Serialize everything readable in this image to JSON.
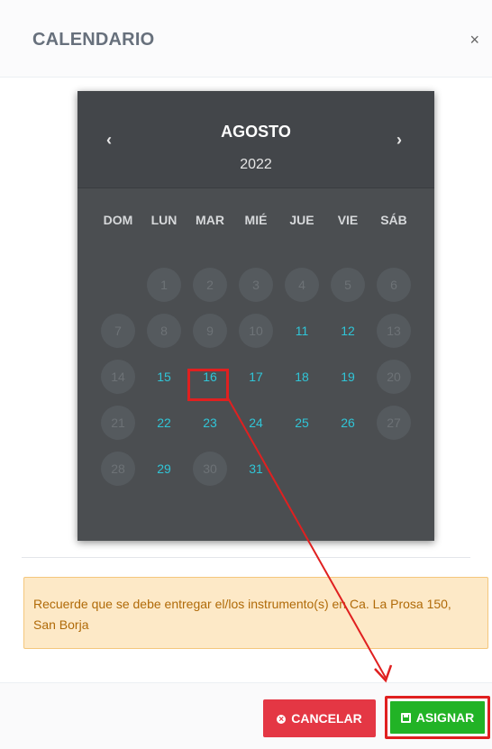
{
  "modal": {
    "title": "CALENDARIO",
    "close_icon": "×"
  },
  "calendar": {
    "month": "AGOSTO",
    "year": "2022",
    "prev_icon": "‹",
    "next_icon": "›",
    "weekdays": [
      "DOM",
      "LUN",
      "MAR",
      "MIÉ",
      "JUE",
      "VIE",
      "SÁB"
    ],
    "weeks": [
      [
        {
          "day": "",
          "state": "blank"
        },
        {
          "day": "1",
          "state": "disabled"
        },
        {
          "day": "2",
          "state": "disabled"
        },
        {
          "day": "3",
          "state": "disabled"
        },
        {
          "day": "4",
          "state": "disabled"
        },
        {
          "day": "5",
          "state": "disabled"
        },
        {
          "day": "6",
          "state": "disabled"
        }
      ],
      [
        {
          "day": "7",
          "state": "disabled"
        },
        {
          "day": "8",
          "state": "disabled"
        },
        {
          "day": "9",
          "state": "disabled"
        },
        {
          "day": "10",
          "state": "disabled"
        },
        {
          "day": "11",
          "state": "available"
        },
        {
          "day": "12",
          "state": "available"
        },
        {
          "day": "13",
          "state": "disabled"
        }
      ],
      [
        {
          "day": "14",
          "state": "disabled"
        },
        {
          "day": "15",
          "state": "available"
        },
        {
          "day": "16",
          "state": "available"
        },
        {
          "day": "17",
          "state": "available"
        },
        {
          "day": "18",
          "state": "available"
        },
        {
          "day": "19",
          "state": "available"
        },
        {
          "day": "20",
          "state": "disabled"
        }
      ],
      [
        {
          "day": "21",
          "state": "disabled"
        },
        {
          "day": "22",
          "state": "available"
        },
        {
          "day": "23",
          "state": "available"
        },
        {
          "day": "24",
          "state": "available"
        },
        {
          "day": "25",
          "state": "available"
        },
        {
          "day": "26",
          "state": "available"
        },
        {
          "day": "27",
          "state": "disabled"
        }
      ],
      [
        {
          "day": "28",
          "state": "disabled"
        },
        {
          "day": "29",
          "state": "available"
        },
        {
          "day": "30",
          "state": "disabled"
        },
        {
          "day": "31",
          "state": "available"
        },
        {
          "day": "",
          "state": "blank"
        },
        {
          "day": "",
          "state": "blank"
        },
        {
          "day": "",
          "state": "blank"
        }
      ]
    ],
    "highlighted_day": "16"
  },
  "alert": {
    "text": "Recuerde que se debe entregar el/los instrumento(s) en Ca. La Prosa 150, San Borja"
  },
  "footer": {
    "cancel_label": "CANCELAR",
    "cancel_icon": "circle-x-icon",
    "assign_label": "ASIGNAR",
    "assign_icon": "save-icon"
  },
  "colors": {
    "calendar_bg": "#4b4e51",
    "available_day": "#30c5d7",
    "cancel_button": "#e43744",
    "assign_button": "#22b326",
    "annotation_red": "#e02020",
    "alert_bg": "#fde9c7",
    "alert_text": "#b06a08"
  }
}
